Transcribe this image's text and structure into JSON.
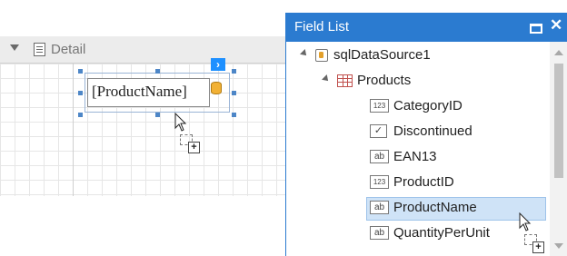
{
  "designer": {
    "band_title": "Detail",
    "label_text": "[ProductName]",
    "smart_tag_glyph": "›"
  },
  "field_list": {
    "title": "Field List",
    "maximize_icon": "maximize-icon",
    "close_glyph": "✕",
    "datasource": {
      "label": "sqlDataSource1",
      "icon": "datasource-icon"
    },
    "table": {
      "label": "Products",
      "icon": "table-icon"
    },
    "fields": [
      {
        "label": "CategoryID",
        "type_icon": "123"
      },
      {
        "label": "Discontinued",
        "type_icon": "✓"
      },
      {
        "label": "EAN13",
        "type_icon": "ab"
      },
      {
        "label": "ProductID",
        "type_icon": "123"
      },
      {
        "label": "ProductName",
        "type_icon": "ab",
        "selected": true
      },
      {
        "label": "QuantityPerUnit",
        "type_icon": "ab"
      }
    ]
  },
  "cursor_plus": "+",
  "colors": {
    "panel_header": "#2b7bd0",
    "selection": "#cfe3f7",
    "smart_tag": "#1e90ff",
    "handle": "#4d86c7"
  }
}
